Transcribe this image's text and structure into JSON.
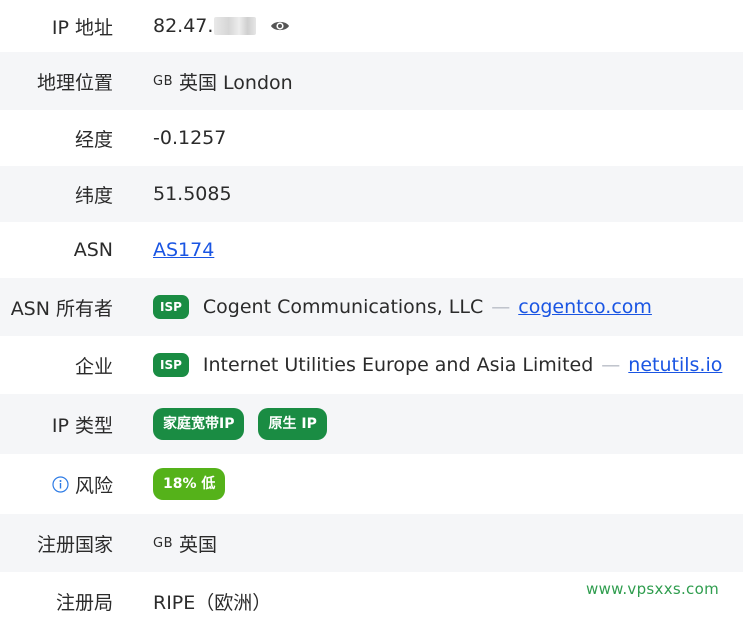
{
  "rows": {
    "ip": {
      "label": "IP 地址",
      "value": "82.47.",
      "icon": "eye-icon"
    },
    "geo": {
      "label": "地理位置",
      "country_code": "GB",
      "value": "英国 London"
    },
    "lon": {
      "label": "经度",
      "value": "-0.1257"
    },
    "lat": {
      "label": "纬度",
      "value": "51.5085"
    },
    "asn": {
      "label": "ASN",
      "value": "AS174"
    },
    "asn_owner": {
      "label": "ASN 所有者",
      "badge": "ISP",
      "name": "Cogent Communications, LLC",
      "dash": "—",
      "domain": "cogentco.com"
    },
    "company": {
      "label": "企业",
      "badge": "ISP",
      "name": "Internet Utilities Europe and Asia Limited",
      "dash": "—",
      "domain": "netutils.io"
    },
    "ip_type": {
      "label": "IP 类型",
      "tags": [
        "家庭宽带IP",
        "原生 IP"
      ]
    },
    "risk": {
      "label": "风险",
      "icon": "info-icon",
      "value": "18% 低"
    },
    "reg_country": {
      "label": "注册国家",
      "country_code": "GB",
      "value": "英国"
    },
    "registry": {
      "label": "注册局",
      "value": "RIPE（欧洲）"
    }
  },
  "watermark": "www.vpsxxs.com",
  "colors": {
    "accent_green": "#1a8c43",
    "risk_green": "#55b21a",
    "link_blue": "#1a55e3",
    "row_alt": "#f5f6f8"
  }
}
